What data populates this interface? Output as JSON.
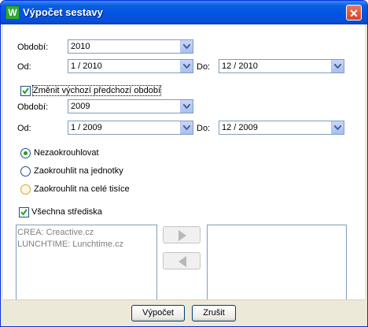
{
  "window": {
    "title": "Výpočet sestavy",
    "icon_letter": "W"
  },
  "period_main": {
    "obdobi_label": "Období:",
    "obdobi_value": "2010",
    "od_label": "Od:",
    "od_value": "1 / 2010",
    "do_label": "Do:",
    "do_value": "12 / 2010"
  },
  "previous_period": {
    "checkbox_label": "Změnit výchozí předchozí období",
    "checked": true,
    "obdobi_label": "Období:",
    "obdobi_value": "2009",
    "od_label": "Od:",
    "od_value": "1 / 2009",
    "do_label": "Do:",
    "do_value": "12 / 2009"
  },
  "rounding": {
    "options": [
      {
        "label": "Nezaokrouhlovat",
        "selected": true
      },
      {
        "label": "Zaokrouhlit na jednotky",
        "selected": false
      },
      {
        "label": "Zaokrouhlit na celé tisíce",
        "selected": false
      }
    ]
  },
  "centers": {
    "checkbox_label": "Všechna střediska",
    "checked": true,
    "available": [
      "CREA: Creactive.cz",
      "LUNCHTIME: Lunchtime.cz"
    ],
    "selected": []
  },
  "buttons": {
    "compute": "Výpočet",
    "cancel": "Zrušit"
  }
}
